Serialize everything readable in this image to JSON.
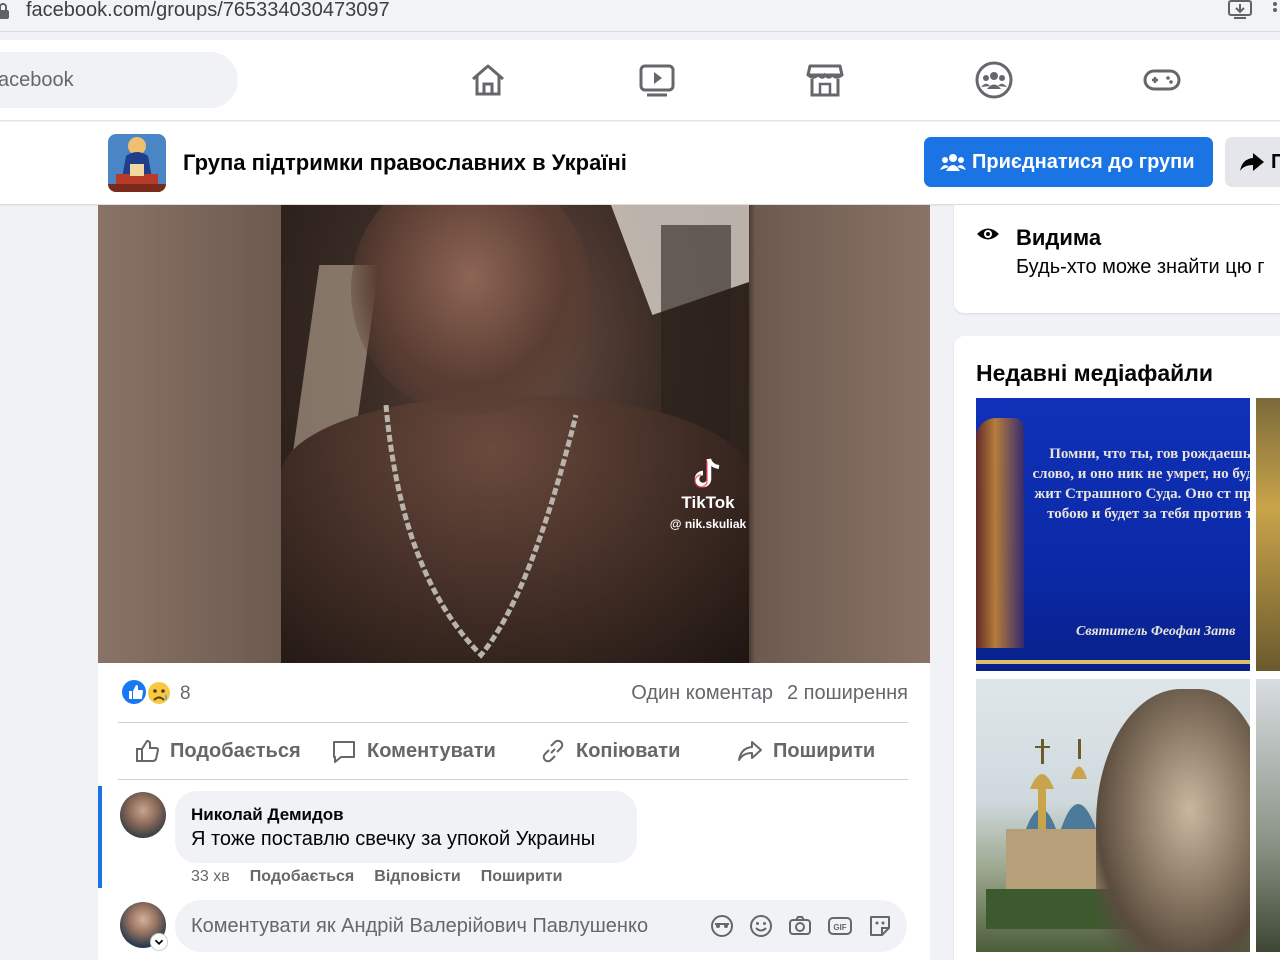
{
  "browser": {
    "url": "facebook.com/groups/765334030473097"
  },
  "topnav": {
    "search_text": "acebook",
    "icons": [
      "home-icon",
      "video-icon",
      "marketplace-icon",
      "groups-icon",
      "gaming-icon"
    ]
  },
  "group": {
    "title": "Група підтримки православних в Україні",
    "join_label": "Приєднатися до групи",
    "share_label": "П"
  },
  "post": {
    "watermark_brand": "TikTok",
    "watermark_handle": "@ nik.skuliak",
    "reaction_count": "8",
    "reactions": [
      "like",
      "sad"
    ],
    "comments_count": "Один коментар",
    "shares_count": "2 поширення",
    "actions": {
      "like": "Подобається",
      "comment": "Коментувати",
      "copy": "Копіювати",
      "share": "Поширити"
    },
    "comment": {
      "author": "Николай Демидов",
      "text": "Я тоже поставлю свечку за упокой Украины",
      "time": "33 хв",
      "like": "Подобається",
      "reply": "Відповісти",
      "share": "Поширити"
    },
    "compose_placeholder": "Коментувати як Андрій Валерійович Павлушенко"
  },
  "sidebar": {
    "visibility_title": "Видима",
    "visibility_desc": "Будь-хто може знайти цю г",
    "media_title": "Недавні медіафайли",
    "media_text": "Помни, что ты, гов рождаешь слово, и оно ник не умрет, но будет жит Страшного Суда. Оно ст пред тобою и будет за тебя против т",
    "media_signature": "Святитель Феофан Затв"
  },
  "colors": {
    "accent": "#1b74e4",
    "background": "#f0f2f5",
    "secondary_text": "#65676b"
  }
}
